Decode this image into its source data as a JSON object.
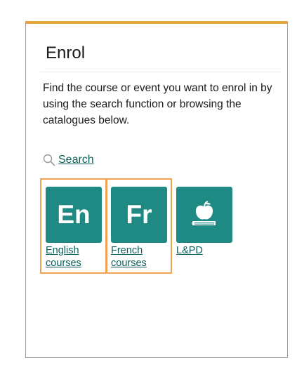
{
  "card": {
    "title": "Enrol",
    "description": "Find the course or event you want to enrol in by using the search function or browsing the catalogues below.",
    "search_label": "Search",
    "tiles": [
      {
        "abbr": "En",
        "label_line1": "English",
        "label_line2": "courses"
      },
      {
        "abbr": "Fr",
        "label_line1": "French",
        "label_line2": "courses"
      },
      {
        "icon": "apple-book-icon",
        "label_line1": "L&PD"
      }
    ]
  },
  "colors": {
    "accent_top": "#e8a33d",
    "tile_bg": "#1f8a84",
    "link": "#0c5e5a",
    "highlight": "#f0a254"
  }
}
